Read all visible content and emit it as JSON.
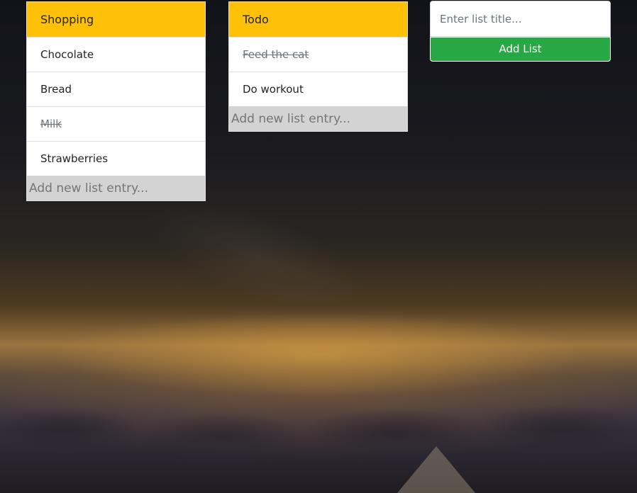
{
  "lists": [
    {
      "title": "Shopping",
      "entries": [
        {
          "text": "Chocolate",
          "done": false
        },
        {
          "text": "Bread",
          "done": false
        },
        {
          "text": "Milk",
          "done": true
        },
        {
          "text": "Strawberries",
          "done": false
        }
      ],
      "new_entry_placeholder": "Add new list entry..."
    },
    {
      "title": "Todo",
      "entries": [
        {
          "text": "Feed the cat",
          "done": true
        },
        {
          "text": "Do workout",
          "done": false
        }
      ],
      "new_entry_placeholder": "Add new list entry..."
    }
  ],
  "new_list": {
    "title_placeholder": "Enter list title...",
    "title_value": "",
    "add_button_label": "Add List"
  },
  "colors": {
    "list_header": "#ffc107",
    "add_button": "#28a745",
    "new_entry_background": "#d3d3d3"
  }
}
